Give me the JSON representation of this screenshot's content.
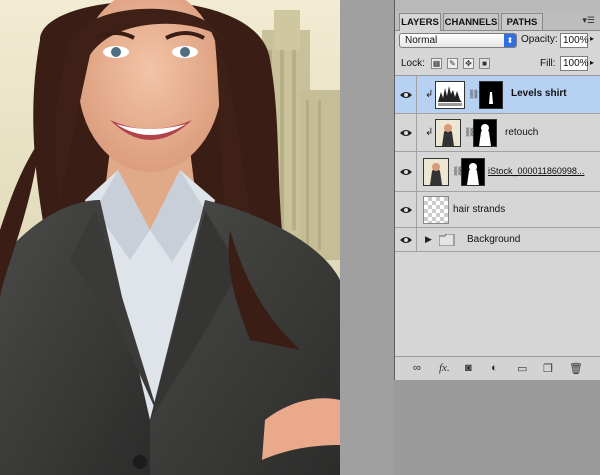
{
  "panel": {
    "tabs": [
      "LAYERS",
      "CHANNELS",
      "PATHS"
    ],
    "active_tab": "LAYERS",
    "menu_icon": "panel-menu-icon",
    "blend_mode": "Normal",
    "opacity_label": "Opacity:",
    "opacity_value": "100%",
    "lock_label": "Lock:",
    "fill_label": "Fill:",
    "fill_value": "100%",
    "lock_icons": [
      "lock-transparent-icon",
      "lock-image-icon",
      "lock-position-icon",
      "lock-all-icon"
    ],
    "layers": [
      {
        "name": "Levels shirt",
        "selected": true,
        "clipped": true,
        "type": "adjustment-levels"
      },
      {
        "name": "retouch",
        "selected": false,
        "clipped": true,
        "type": "image-with-mask"
      },
      {
        "name": "iStock_000011860998...",
        "selected": false,
        "clipped": false,
        "type": "image-with-mask"
      },
      {
        "name": "hair strands",
        "selected": false,
        "clipped": false,
        "type": "transparent"
      },
      {
        "name": "Background",
        "selected": false,
        "clipped": false,
        "type": "group"
      }
    ],
    "bottom_icons": [
      "link-layers-icon",
      "fx-icon",
      "add-mask-icon",
      "adjustment-layer-icon",
      "new-group-icon",
      "new-layer-icon",
      "trash-icon"
    ],
    "fx_label": "fx."
  },
  "colors": {
    "panel_bg": "#d6d6d6",
    "selected_row": "#b7d1f3",
    "canvas_gray": "#9b9b9b"
  }
}
